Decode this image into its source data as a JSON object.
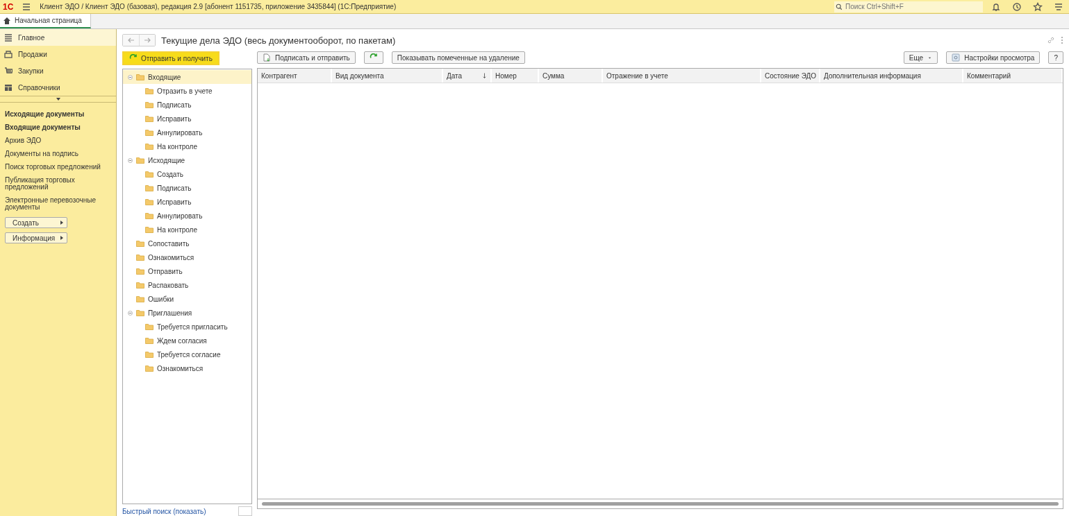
{
  "app_bar": {
    "logo": "1С",
    "title": "Клиент ЭДО / Клиент ЭДО (базовая), редакция 2.9 [абонент 1151735, приложение 3435844]  (1С:Предприятие)",
    "search": {
      "placeholder": "Поиск Ctrl+Shift+F"
    }
  },
  "tabs": [
    {
      "label": "Начальная страница",
      "selected": true
    }
  ],
  "sections": [
    {
      "label": "Главное",
      "selected": true,
      "kind": "menu"
    },
    {
      "label": "Продажи",
      "selected": false,
      "kind": "sales"
    },
    {
      "label": "Закупки",
      "selected": false,
      "kind": "purchases"
    },
    {
      "label": "Справочники",
      "selected": false,
      "kind": "catalogs"
    }
  ],
  "nav_links": [
    {
      "label": "Исходящие документы",
      "bold": true
    },
    {
      "label": "Входящие документы",
      "bold": true
    },
    {
      "label": "Архив ЭДО",
      "bold": false
    },
    {
      "label": "Документы на подпись",
      "bold": false
    },
    {
      "label": "Поиск торговых предложений",
      "bold": false
    },
    {
      "label": "Публикация торговых предложений",
      "bold": false
    },
    {
      "label": "Электронные перевозочные документы",
      "bold": false
    }
  ],
  "sidebar_buttons": [
    "Создать",
    "Информация"
  ],
  "page": {
    "title": "Текущие дела ЭДО (весь документооборот, по пакетам)",
    "send_button": "Отправить и получить",
    "toolbar": [
      {
        "label": "Подписать и отправить",
        "kind": "sign"
      },
      {
        "kind": "refresh"
      },
      {
        "label": "Показывать помеченные на удаление",
        "kind": "plain"
      }
    ],
    "more_button": "Еще",
    "settings_button": "Настройки просмотра",
    "help_button": "?"
  },
  "tree": [
    {
      "label": "Входящие",
      "selected": true,
      "expanded": true,
      "children": [
        {
          "label": "Отразить в учете",
          "selected": false
        },
        {
          "label": "Подписать",
          "selected": false
        },
        {
          "label": "Исправить",
          "selected": false
        },
        {
          "label": "Аннулировать",
          "selected": false
        },
        {
          "label": "На контроле",
          "selected": false
        }
      ]
    },
    {
      "label": "Исходящие",
      "selected": false,
      "expanded": true,
      "children": [
        {
          "label": "Создать",
          "selected": false
        },
        {
          "label": "Подписать",
          "selected": false
        },
        {
          "label": "Исправить",
          "selected": false
        },
        {
          "label": "Аннулировать",
          "selected": false
        },
        {
          "label": "На контроле",
          "selected": false
        }
      ]
    },
    {
      "label": "Сопоставить",
      "selected": false
    },
    {
      "label": "Ознакомиться",
      "selected": false
    },
    {
      "label": "Отправить",
      "selected": false
    },
    {
      "label": "Распаковать",
      "selected": false
    },
    {
      "label": "Ошибки",
      "selected": false
    },
    {
      "label": "Приглашения",
      "selected": false,
      "expanded": true,
      "children": [
        {
          "label": "Требуется пригласить",
          "selected": false
        },
        {
          "label": "Ждем согласия",
          "selected": false
        },
        {
          "label": "Требуется согласие",
          "selected": false
        },
        {
          "label": "Ознакомиться",
          "selected": false
        }
      ]
    }
  ],
  "table": {
    "columns": [
      {
        "label": "Контрагент",
        "sorted": false
      },
      {
        "label": "Вид документа",
        "sorted": false
      },
      {
        "label": "Дата",
        "sorted": true
      },
      {
        "label": "Номер",
        "sorted": false
      },
      {
        "label": "Сумма",
        "sorted": false
      },
      {
        "label": "Отражение в учете",
        "sorted": false
      },
      {
        "label": "Состояние ЭДО",
        "sorted": false
      },
      {
        "label": "Дополнительная информация",
        "sorted": false
      },
      {
        "label": "Комментарий",
        "sorted": false
      }
    ]
  },
  "quick_search": "Быстрый поиск (показать)"
}
